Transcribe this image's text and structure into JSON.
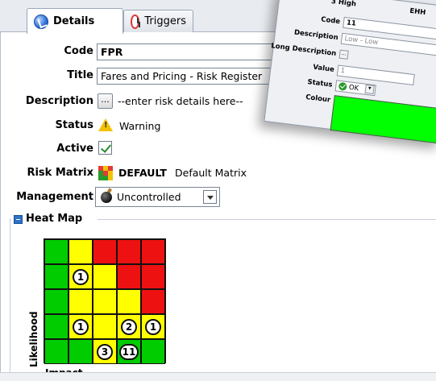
{
  "tabs": [
    {
      "label": "Details",
      "icon": "details-badge-icon",
      "active": true
    },
    {
      "label": "Triggers",
      "icon": "clock-icon",
      "active": false
    }
  ],
  "form": {
    "code_label": "Code",
    "code_value": "FPR",
    "title_label": "Title",
    "title_value": "Fares and Pricing - Risk Register",
    "description_label": "Description",
    "description_button": "...",
    "description_value": "--enter risk details here--",
    "status_label": "Status",
    "status_value": "Warning",
    "active_label": "Active",
    "active_checked": true,
    "risk_matrix_label": "Risk Matrix",
    "risk_matrix_code": "DEFAULT",
    "risk_matrix_name": "Default Matrix",
    "management_label": "Management",
    "management_value": "Uncontrolled"
  },
  "heat_map": {
    "title": "Heat Map",
    "ylabel": "Likelihood",
    "xlabel": "Impact",
    "colors": {
      "green": "#00cc00",
      "yellow": "#ffff00",
      "red": "#ee1111"
    },
    "rows": [
      [
        "green",
        "yellow",
        "red",
        "red",
        "red"
      ],
      [
        "green",
        "yellow",
        "yellow",
        "red",
        "red"
      ],
      [
        "green",
        "yellow",
        "yellow",
        "yellow",
        "red"
      ],
      [
        "green",
        "yellow",
        "yellow",
        "yellow",
        "yellow"
      ],
      [
        "green",
        "green",
        "yellow",
        "green",
        "green"
      ]
    ],
    "badges": [
      {
        "row": 1,
        "col": 1,
        "count": "1"
      },
      {
        "row": 3,
        "col": 1,
        "count": "1"
      },
      {
        "row": 3,
        "col": 3,
        "count": "2"
      },
      {
        "row": 3,
        "col": 4,
        "count": "1"
      },
      {
        "row": 4,
        "col": 2,
        "count": "3"
      },
      {
        "row": 4,
        "col": 3,
        "count": "11"
      }
    ]
  },
  "overlay": {
    "header_left": "3 High",
    "header_right": "EHH",
    "code_label": "Code",
    "code_value": "11",
    "description_label": "Description",
    "description_value": "Low - Low",
    "long_description_label": "Long Description",
    "long_description_button": "...",
    "value_label": "Value",
    "value_value": "1",
    "status_label": "Status",
    "status_value": "OK",
    "colour_label": "Colour",
    "colour_value": "#00ff00"
  }
}
